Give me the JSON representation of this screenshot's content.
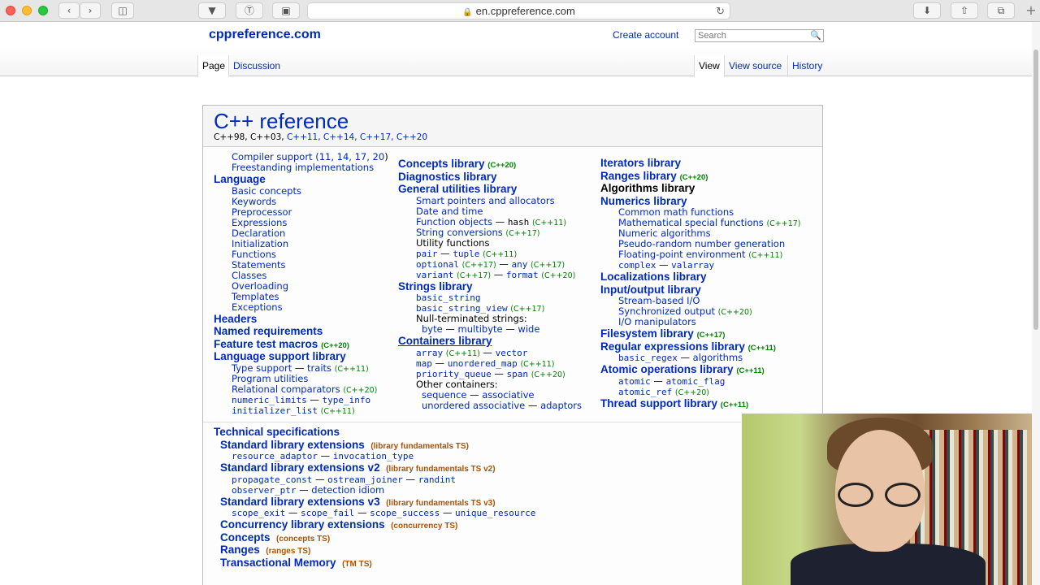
{
  "browser": {
    "url": "en.cppreference.com",
    "colors": {
      "chrome": "#e7e6e7"
    }
  },
  "site": {
    "name": "cppreference.com",
    "create_account": "Create account",
    "search_placeholder": "Search",
    "tabs_left": [
      "Page",
      "Discussion"
    ],
    "tabs_right": [
      "View",
      "View source",
      "History"
    ],
    "link_color": "#002bb8"
  },
  "main": {
    "title": "C++ reference",
    "versions": {
      "plain": "C++98, C++03, ",
      "linked": "C++11, C++14, C++17, C++20"
    },
    "col1": {
      "compiler_support": "Compiler support (",
      "compiler_versions": "11, 14, 17, 20",
      "compiler_close": ")",
      "freestanding": "Freestanding implementations",
      "language": "Language",
      "language_items": [
        "Basic concepts",
        "Keywords",
        "Preprocessor",
        "Expressions",
        "Declaration",
        "Initialization",
        "Functions",
        "Statements",
        "Classes",
        "Overloading",
        "Templates",
        "Exceptions"
      ],
      "headers": "Headers",
      "named_requirements": "Named requirements",
      "feature_test": "Feature test macros",
      "feature_test_ver": "(C++20)",
      "lang_support": "Language support library",
      "type_support": "Type support",
      "traits": "traits",
      "traits_ver": "(C++11)",
      "program_utilities": "Program utilities",
      "relational": "Relational comparators",
      "relational_ver": "(C++20)",
      "numeric_limits": "numeric_limits",
      "type_info": "type_info",
      "initializer_list": "initializer_list",
      "initializer_list_ver": "(C++11)"
    },
    "col2": {
      "concepts": "Concepts library",
      "concepts_ver": "(C++20)",
      "diagnostics": "Diagnostics library",
      "general": "General utilities library",
      "smart_pointers": "Smart pointers and allocators",
      "date_time": "Date and time",
      "function_objects": "Function objects",
      "hash": "hash",
      "hash_ver": "(C++11)",
      "string_conversions": "String conversions",
      "string_conversions_ver": "(C++17)",
      "utility_functions": "Utility functions",
      "pair": "pair",
      "tuple": "tuple",
      "tuple_ver": "(C++11)",
      "optional": "optional",
      "optional_ver": "(C++17)",
      "any": "any",
      "any_ver": "(C++17)",
      "variant": "variant",
      "variant_ver": "(C++17)",
      "format": "format",
      "format_ver": "(C++20)",
      "strings": "Strings library",
      "basic_string": "basic_string",
      "basic_string_view": "basic_string_view",
      "basic_string_view_ver": "(C++17)",
      "null_terminated": "Null-terminated strings:",
      "byte": "byte",
      "multibyte": "multibyte",
      "wide": "wide",
      "containers": "Containers library",
      "array": "array",
      "array_ver": "(C++11)",
      "vector": "vector",
      "map": "map",
      "unordered_map": "unordered_map",
      "unordered_map_ver": "(C++11)",
      "priority_queue": "priority_queue",
      "span": "span",
      "span_ver": "(C++20)",
      "other_containers": "Other containers:",
      "sequence": "sequence",
      "associative": "associative",
      "unordered_associative": "unordered associative",
      "adaptors": "adaptors"
    },
    "col3": {
      "iterators": "Iterators library",
      "ranges": "Ranges library",
      "ranges_ver": "(C++20)",
      "algorithms": "Algorithms library",
      "numerics": "Numerics library",
      "common_math": "Common math functions",
      "special_math": "Mathematical special functions",
      "special_math_ver": "(C++17)",
      "numeric_algorithms": "Numeric algorithms",
      "prng": "Pseudo-random number generation",
      "fpenv": "Floating-point environment",
      "fpenv_ver": "(C++11)",
      "complex": "complex",
      "valarray": "valarray",
      "localizations": "Localizations library",
      "io": "Input/output library",
      "stream_io": "Stream-based I/O",
      "sync_output": "Synchronized output",
      "sync_output_ver": "(C++20)",
      "io_manipulators": "I/O manipulators",
      "filesystem": "Filesystem library",
      "filesystem_ver": "(C++17)",
      "regex": "Regular expressions library",
      "regex_ver": "(C++11)",
      "basic_regex": "basic_regex",
      "regex_algorithms": "algorithms",
      "atomic": "Atomic operations library",
      "atomic_ver": "(C++11)",
      "atomic_t": "atomic",
      "atomic_flag": "atomic_flag",
      "atomic_ref": "atomic_ref",
      "atomic_ref_ver": "(C++20)",
      "thread": "Thread support library",
      "thread_ver": "(C++11)"
    },
    "tech": {
      "title": "Technical specifications",
      "std_ext": "Standard library extensions",
      "std_ext_ts": "(library fundamentals TS)",
      "resource_adaptor": "resource_adaptor",
      "invocation_type": "invocation_type",
      "std_ext_v2": "Standard library extensions v2",
      "std_ext_v2_ts": "(library fundamentals TS v2)",
      "propagate_const": "propagate_const",
      "ostream_joiner": "ostream_joiner",
      "randint": "randint",
      "observer_ptr": "observer_ptr",
      "detection_idiom": "detection idiom",
      "std_ext_v3": "Standard library extensions v3",
      "std_ext_v3_ts": "(library fundamentals TS v3)",
      "scope_exit": "scope_exit",
      "scope_fail": "scope_fail",
      "scope_success": "scope_success",
      "unique_resource": "unique_resource",
      "concurrency": "Concurrency library extensions",
      "concurrency_ts": "(concurrency TS)",
      "concepts": "Concepts",
      "concepts_ts": "(concepts TS)",
      "ranges": "Ranges",
      "ranges_ts": "(ranges TS)",
      "transactional": "Transactional Memory",
      "transactional_ts": "(TM TS)"
    }
  }
}
